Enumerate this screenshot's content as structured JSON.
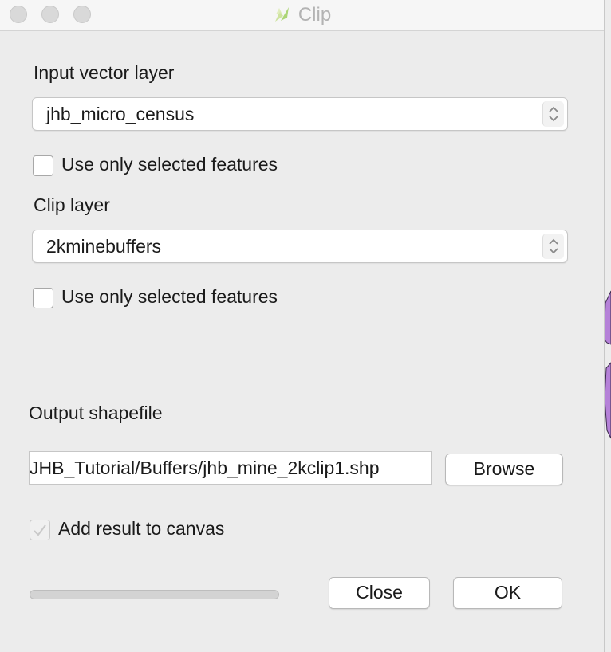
{
  "window": {
    "title": "Clip"
  },
  "input_layer": {
    "label": "Input vector layer",
    "value": "jhb_micro_census",
    "use_selected_label": "Use only selected features",
    "use_selected_checked": false
  },
  "clip_layer": {
    "label": "Clip layer",
    "value": "2kminebuffers",
    "use_selected_label": "Use only selected features",
    "use_selected_checked": false
  },
  "output": {
    "label": "Output shapefile",
    "value": "JHB_Tutorial/Buffers/jhb_mine_2kclip1.shp",
    "browse_label": "Browse"
  },
  "add_to_canvas": {
    "label": "Add result to canvas",
    "checked": true,
    "enabled": false
  },
  "progress": {
    "fraction": 0
  },
  "buttons": {
    "close_label": "Close",
    "ok_label": "OK"
  },
  "colors": {
    "background_layer_fill": "#b581d8"
  },
  "icons": {
    "title": "qgis-logo-icon",
    "select_arrows": "chevron-updown-icon",
    "check": "checkmark-icon"
  }
}
